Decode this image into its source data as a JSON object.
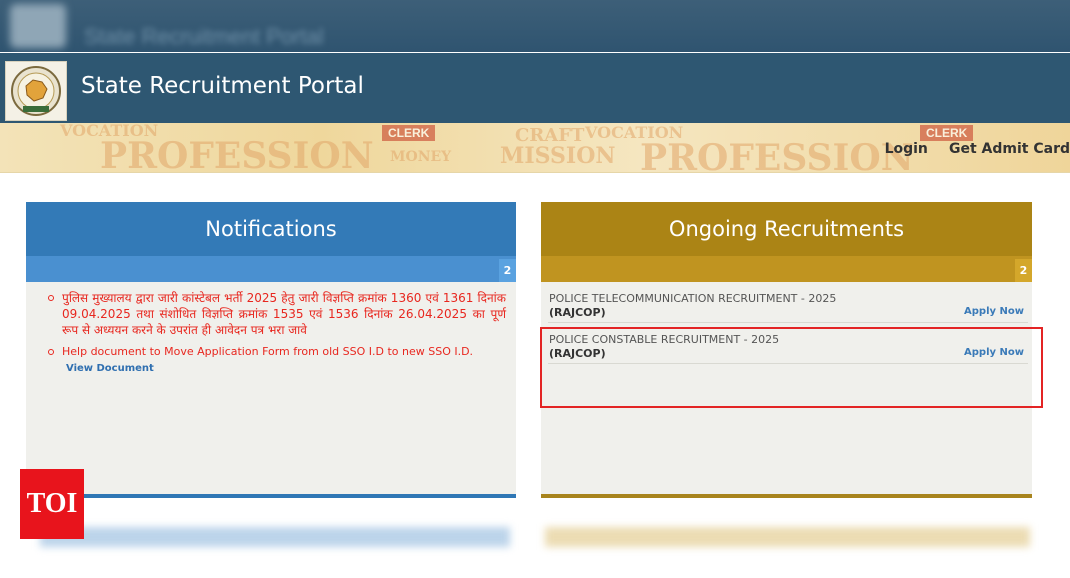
{
  "header": {
    "title": "State Recruitment Portal"
  },
  "nav": {
    "login": "Login",
    "admit_card": "Get Admit Card"
  },
  "notifications": {
    "heading": "Notifications",
    "count": "2",
    "items": [
      {
        "text": "पुलिस मुख्यालय द्वारा जारी कांस्टेबल भर्ती 2025 हेतु जारी विज्ञप्ति क्रमांक 1360 एवं 1361 दिनांक 09.04.2025 तथा संशोधित विज्ञप्ति क्रमांक 1535 एवं 1536 दिनांक 26.04.2025 का पूर्ण रूप से अध्ययन करने के उपरांत ही आवेदन पत्र भरा जावे",
        "link": ""
      },
      {
        "text": "Help document to Move Application Form from old SSO I.D to new SSO I.D.",
        "link": "View Document"
      }
    ]
  },
  "recruitments": {
    "heading": "Ongoing Recruitments",
    "count": "2",
    "apply_label": "Apply Now",
    "items": [
      {
        "title": "POLICE TELECOMMUNICATION RECRUITMENT - 2025",
        "org": "(RAJCOP)"
      },
      {
        "title": "POLICE CONSTABLE RECRUITMENT - 2025",
        "org": "(RAJCOP)"
      }
    ]
  },
  "banner": {
    "words": [
      "VOCATION",
      "PROFESSION",
      "CLERK",
      "MONEY",
      "MISSION",
      "CRAFT",
      "VOCATION",
      "PROFESSION",
      "CLERK"
    ]
  },
  "watermark": {
    "label": "TOI"
  },
  "colors": {
    "header_bg": "#2e5772",
    "notifications_accent": "#337ab7",
    "recruitments_accent": "#ab8415",
    "notice_text": "#e8271f",
    "highlight_border": "#e32424",
    "toi_red": "#e8141c"
  }
}
